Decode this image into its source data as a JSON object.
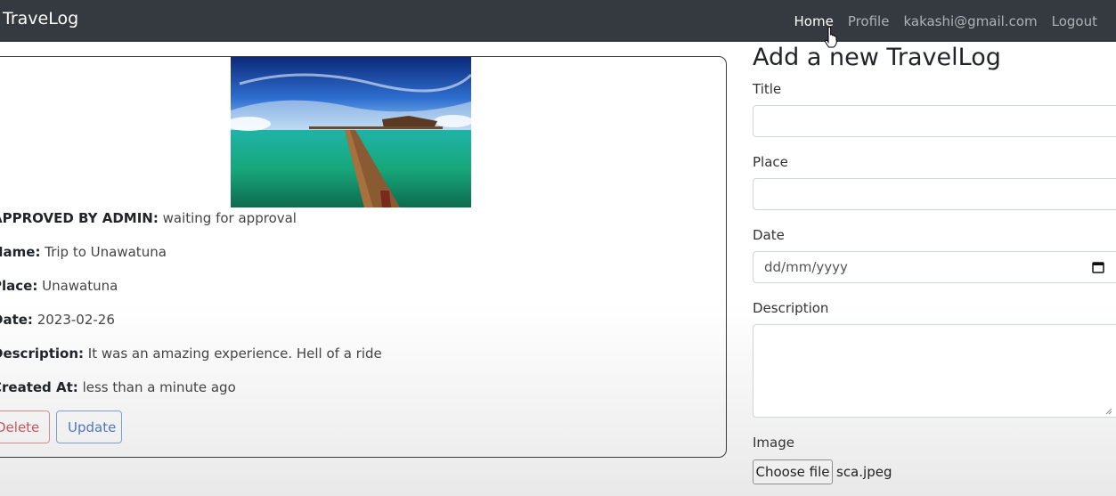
{
  "navbar": {
    "brand": "TraveLog",
    "links": [
      "Home",
      "Profile",
      "kakashi@gmail.com",
      "Logout"
    ],
    "active_link": "Home"
  },
  "travel_log": {
    "approved_label": "APPROVED BY ADMIN:",
    "approved_value": "waiting for approval",
    "name_label": "Name:",
    "name_value": "Trip to Unawatuna",
    "place_label": "Place:",
    "place_value": "Unawatuna",
    "date_label": "Date:",
    "date_value": "2023-02-26",
    "description_label": "Description:",
    "description_value": "It was an amazing experience. Hell of a ride",
    "created_label": "Created At:",
    "created_value": "less than a minute ago",
    "delete_label": "Delete",
    "update_label": "Update"
  },
  "form": {
    "title": "Add a new TravelLog",
    "title_label": "Title",
    "place_label": "Place",
    "date_label": "Date",
    "date_placeholder": "dd/mm/yyyy",
    "description_label": "Description",
    "image_label": "Image",
    "choose_file_label": "Choose file",
    "file_name": "sca.jpeg"
  },
  "colors": {
    "navbar_bg": "#343a40",
    "delete": "#c9545e",
    "update": "#4d78bf"
  }
}
